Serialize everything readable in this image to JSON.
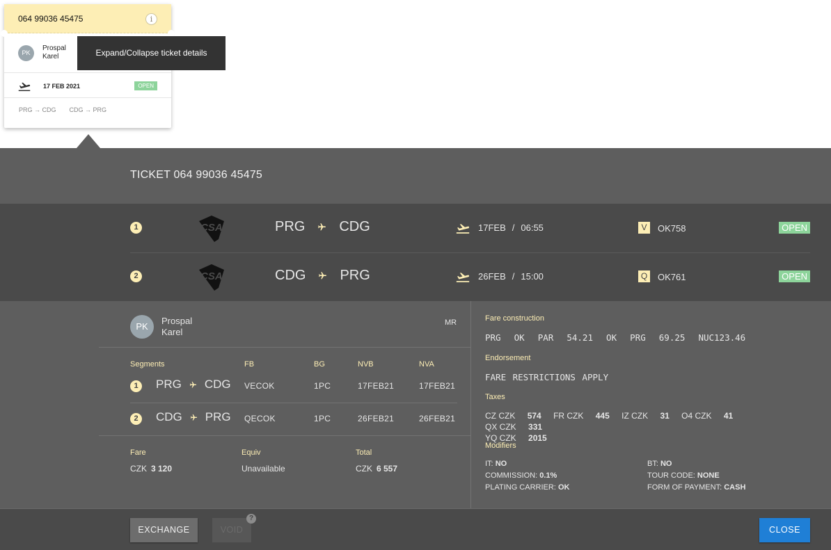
{
  "card": {
    "ticket_number": "064 99036 45475",
    "avatar": "PK",
    "first_line": "Prospal",
    "second_line": "Karel",
    "date": "17 FEB 2021",
    "status": "OPEN",
    "routes": [
      "PRG → CDG",
      "CDG → PRG"
    ],
    "info_icon": "info-icon"
  },
  "tooltip": "Expand/Collapse ticket details",
  "panel": {
    "title": "TICKET 064 99036 45475"
  },
  "segments": [
    {
      "num": "1",
      "from": "PRG",
      "to": "CDG",
      "date": "17FEB",
      "time": "06:55",
      "class": "V",
      "flight": "OK758",
      "status": "OPEN"
    },
    {
      "num": "2",
      "from": "CDG",
      "to": "PRG",
      "date": "26FEB",
      "time": "15:00",
      "class": "Q",
      "flight": "OK761",
      "status": "OPEN"
    }
  ],
  "passenger": {
    "avatar": "PK",
    "first_line": "Prospal",
    "second_line": "Karel",
    "title": "MR"
  },
  "segment_table": {
    "headers": [
      "Segments",
      "FB",
      "BG",
      "NVB",
      "NVA"
    ],
    "rows": [
      {
        "num": "1",
        "from": "PRG",
        "to": "CDG",
        "fb": "VECOK",
        "bg": "1PC",
        "nvb": "17FEB21",
        "nva": "17FEB21"
      },
      {
        "num": "2",
        "from": "CDG",
        "to": "PRG",
        "fb": "QECOK",
        "bg": "1PC",
        "nvb": "26FEB21",
        "nva": "26FEB21"
      }
    ]
  },
  "fare": {
    "fare_label": "Fare",
    "fare_currency": "CZK",
    "fare_amount": "3 120",
    "equiv_label": "Equiv",
    "equiv_value": "Unavailable",
    "total_label": "Total",
    "total_currency": "CZK",
    "total_amount": "6 557"
  },
  "right": {
    "fare_construction_label": "Fare construction",
    "fare_construction": "PRG  OK  PAR  54.21  OK  PRG  69.25  NUC123.46",
    "endorsement_label": "Endorsement",
    "endorsement": "FARE RESTRICTIONS APPLY",
    "taxes_label": "Taxes",
    "taxes": [
      {
        "code": "CZ CZK",
        "amount": "574"
      },
      {
        "code": "FR CZK",
        "amount": "445"
      },
      {
        "code": "IZ CZK",
        "amount": "31"
      },
      {
        "code": "O4 CZK",
        "amount": "41"
      },
      {
        "code": "QX CZK",
        "amount": "331"
      },
      {
        "code": "YQ CZK",
        "amount": "2015"
      }
    ],
    "modifiers_label": "Modifiers",
    "modifiers": [
      {
        "label": "IT:",
        "value": "NO"
      },
      {
        "label": "BT:",
        "value": "NO"
      },
      {
        "label": "COMMISSION:",
        "value": "0.1%"
      },
      {
        "label": "TOUR CODE:",
        "value": "NONE"
      },
      {
        "label": "PLATING CARRIER:",
        "value": "OK"
      },
      {
        "label": "FORM OF PAYMENT:",
        "value": "CASH"
      }
    ]
  },
  "footer": {
    "exchange": "EXCHANGE",
    "void": "VOID",
    "void_help": "?",
    "close": "CLOSE"
  },
  "colors": {
    "ticket_yellow": "#fdeeb5",
    "open_green": "#8dd49b",
    "close_blue": "#1f7fd6",
    "panel_gray": "#5e5e5e"
  }
}
